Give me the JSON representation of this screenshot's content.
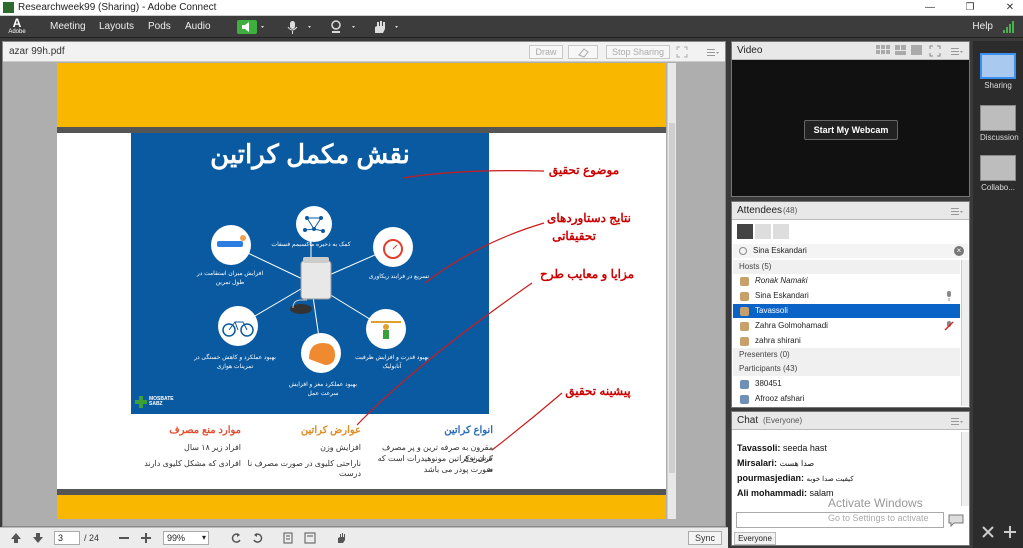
{
  "window": {
    "title": "Researchweek99 (Sharing) - Adobe Connect",
    "controls": [
      "—",
      "❐",
      "✕"
    ]
  },
  "logo": {
    "mark": "A",
    "text": "Adobe"
  },
  "menubar": {
    "items": [
      "Meeting",
      "Layouts",
      "Pods",
      "Audio"
    ],
    "help": "Help"
  },
  "share_pod": {
    "filename": "azar 99h.pdf",
    "draw_label": "Draw",
    "stop_sharing_label": "Stop Sharing"
  },
  "slide": {
    "title": "نقش مکمل کراتین",
    "labels": {
      "top": "کمک به ذخیره ماکسیمم فسفات",
      "left_top": "افزایش میزان استقامت در طول تمرین",
      "right_top": "تسریع در فرایند ریکاوری",
      "left_bottom": "بهبود عملکرد و کاهش خستگی در تمرینات هوازی",
      "right_bottom": "بهبود قدرت و افزایش ظرفیت آنابولیک",
      "bottom": "بهبود عملکرد مغز و افزایش سرعت عمل"
    },
    "brand": "MOSBATE SABZ"
  },
  "annotations": {
    "a1": "موضوع تحقیق",
    "a2_line1": "نتایج دستاوردهای",
    "a2_line2": "تحقیقاتی",
    "a3": "مزایا و معایب طرح",
    "a4": "پیشینه تحقیق"
  },
  "doc_bottom": {
    "col1_title": "موارد منع مصرف",
    "col1_line1": "افراد زیر ۱۸ سال",
    "col1_line2": "افرادی که مشکل کلیوی دارند",
    "col2_title": "عوارض کراتین",
    "col2_line1": "افزایش وزن",
    "col2_line2": "ناراحتی کلیوی در صورت مصرف نا درست",
    "col3_title": "انواع کراتین",
    "col3_line1": "مقرون به صرفه ترین و پر مصرف ترین نوع",
    "col3_line2": "کراتین کراتین مونوهیدرات است که به",
    "col3_line3": "صورت پودر می باشد"
  },
  "footer": {
    "page_current": "3",
    "page_total": "/ 24",
    "zoom": "99%",
    "sync_label": "Sync"
  },
  "video_pod": {
    "title": "Video",
    "webcam_button": "Start My Webcam"
  },
  "attendees": {
    "title": "Attendees",
    "count": "(48)",
    "selected_name": "Sina Eskandari",
    "hosts_label": "Hosts (5)",
    "hosts": [
      "Ronak Namaki",
      "Sina Eskandari",
      "Tavassoli",
      "Zahra Golmohamadi",
      "zahra shirani"
    ],
    "presenters_label": "Presenters (0)",
    "participants_label": "Participants (43)",
    "participants": [
      "380451",
      "Afrooz afshari"
    ]
  },
  "chat": {
    "title": "Chat",
    "scope": "(Everyone)",
    "messages": [
      {
        "user": "Tavassoli:",
        "text": "seeda hast"
      },
      {
        "user": "Mirsalari:",
        "text": "صدا هست"
      },
      {
        "user": "pourmasjedian:",
        "text": "کیفیت صدا خوبه"
      },
      {
        "user": "Ali mohammadi:",
        "text": "salam"
      }
    ],
    "watermark_1": "Activate Windows",
    "watermark_2": "Go to Settings to activate",
    "everyone_tab": "Everyone"
  },
  "layouts": [
    {
      "label": "Sharing"
    },
    {
      "label": "Discussion"
    },
    {
      "label": "Collabo..."
    }
  ]
}
